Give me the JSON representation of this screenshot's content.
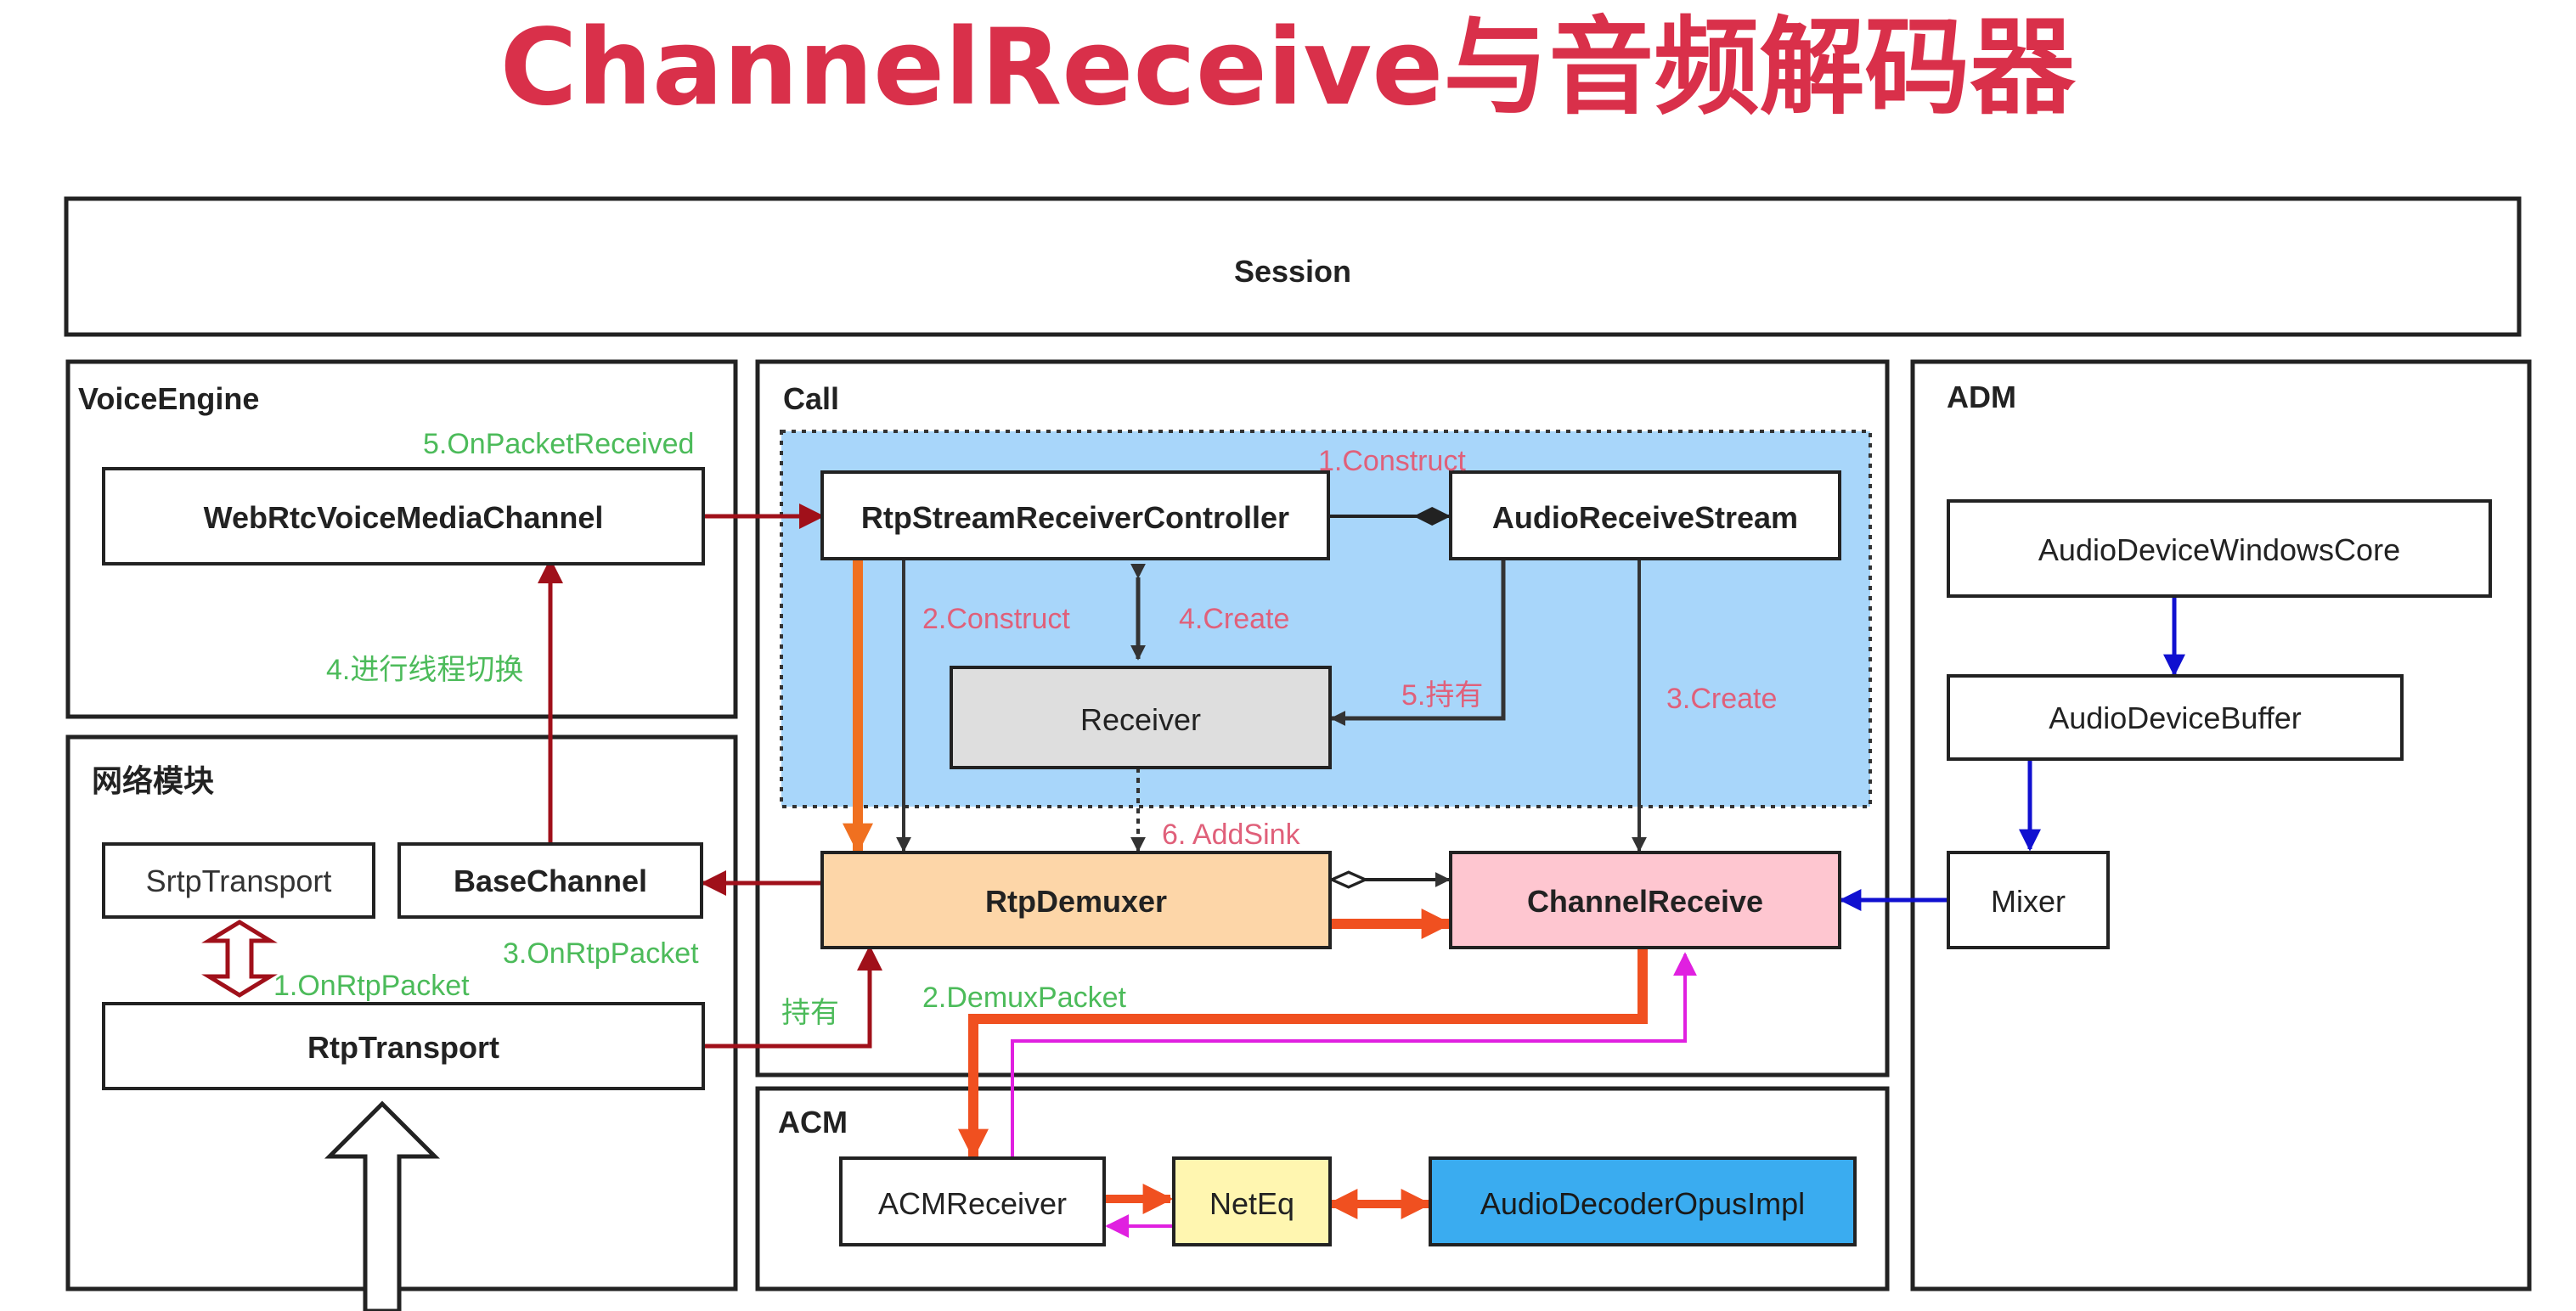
{
  "title": "ChannelReceive与音频解码器",
  "colors": {
    "title": "#d9304a",
    "green_label": "#4cbb5a",
    "pink_label": "#e0607a",
    "dark_red_arrow": "#a0101a",
    "orange_arrow": "#f07020",
    "blue_arrow": "#1010d0",
    "magenta_arrow": "#e020e0",
    "call_region": "#a8d6fa",
    "receiver_fill": "#dedede",
    "demuxer_fill": "#fdd6a8",
    "channel_receive_fill": "#fec6d0",
    "neteq_fill": "#fff6b0",
    "opus_fill": "#3aacf0"
  },
  "containers": {
    "session": "Session",
    "voice_engine": "VoiceEngine",
    "call": "Call",
    "adm": "ADM",
    "network": "网络模块",
    "acm": "ACM"
  },
  "nodes": {
    "webrtc_voice_media_channel": "WebRtcVoiceMediaChannel",
    "rtp_stream_receiver_controller": "RtpStreamReceiverController",
    "audio_receive_stream": "AudioReceiveStream",
    "receiver": "Receiver",
    "rtp_demuxer": "RtpDemuxer",
    "channel_receive": "ChannelReceive",
    "srtp_transport": "SrtpTransport",
    "base_channel": "BaseChannel",
    "rtp_transport": "RtpTransport",
    "audio_device_windows_core": "AudioDeviceWindowsCore",
    "audio_device_buffer": "AudioDeviceBuffer",
    "mixer": "Mixer",
    "acm_receiver": "ACMReceiver",
    "neteq": "NetEq",
    "audio_decoder_opus_impl": "AudioDecoderOpusImpl"
  },
  "edge_labels": {
    "on_packet_received": "5.OnPacketReceived",
    "thread_switch": "4.进行线程切换",
    "on_rtp_packet_3": "3.OnRtpPacket",
    "on_rtp_packet_1": "1.OnRtpPacket",
    "hold_green": "持有",
    "demux_packet": "2.DemuxPacket",
    "construct_1": "1.Construct",
    "construct_2": "2.Construct",
    "create_4": "4.Create",
    "hold_5": "5.持有",
    "create_3": "3.Create",
    "add_sink": "6. AddSink"
  }
}
